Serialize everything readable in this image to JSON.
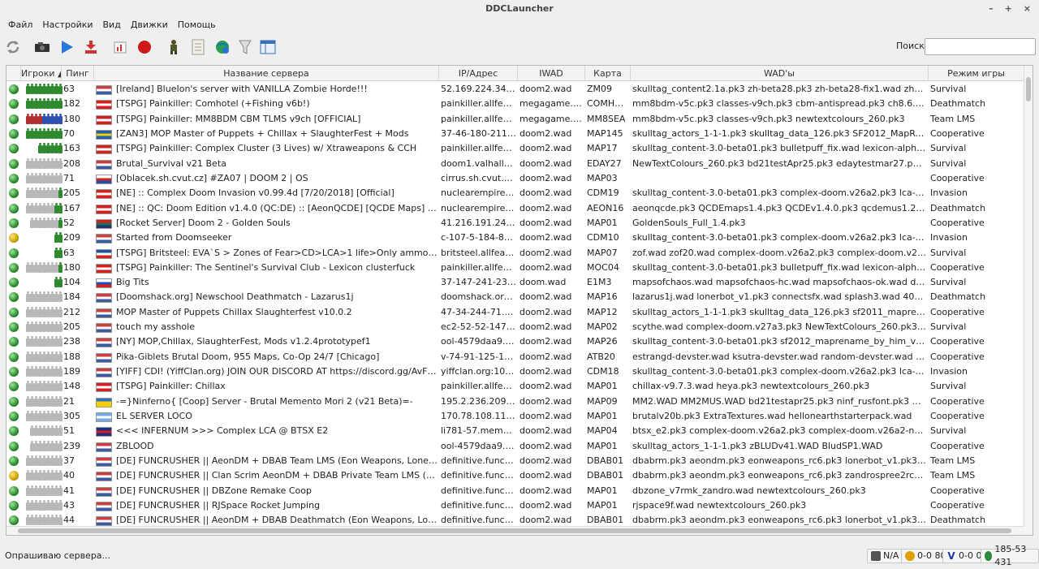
{
  "window": {
    "title": "DDCLauncher",
    "minimize_label": "–",
    "maximize_label": "+",
    "close_label": "×"
  },
  "menu": [
    {
      "label": "Файл"
    },
    {
      "label": "Настройки"
    },
    {
      "label": "Вид"
    },
    {
      "label": "Движки"
    },
    {
      "label": "Помощь"
    }
  ],
  "toolbar": {
    "icons": [
      "refresh-icon",
      "camera-icon",
      "play-icon",
      "download-icon",
      "chart-icon",
      "record-icon",
      "soldier-icon",
      "notes-icon",
      "globe-icon",
      "filter-icon",
      "window-icon"
    ]
  },
  "search": {
    "label": "Поиск:",
    "value": "",
    "placeholder": ""
  },
  "columns": {
    "players": "Игроки",
    "ping": "Пинг",
    "name": "Название сервера",
    "address": "IP/Адрес",
    "iwad": "IWAD",
    "map": "Карта",
    "wads": "WAD'ы",
    "mode": "Режим игры"
  },
  "servers": [
    {
      "players": [
        "g",
        "g",
        "g",
        "g",
        "g",
        "g",
        "g",
        "g",
        "g"
      ],
      "ping": "63",
      "flag": "us",
      "name": "[Ireland] BlueIon's server with VANILLA Zombie Horde!!!",
      "address": "52.169.224.34:106...",
      "iwad": "doom2.wad",
      "map": "ZM09",
      "wads": "skulltag_content2.1a.pk3 zh-beta28.pk3 zh-beta28-fix1.wad zh-testpack_r28.pk...",
      "mode": "Survival",
      "locked": false
    },
    {
      "players": [
        "g",
        "g",
        "g",
        "g",
        "g",
        "g",
        "g",
        "g",
        "g"
      ],
      "ping": "182",
      "flag": "ca",
      "name": "[TSPG] Painkiller: Comhotel (+Fishing v6b!)",
      "address": "painkiller.allfearth...",
      "iwad": "megagame.wad",
      "map": "COMHOT...",
      "wads": "mm8bdm-v5c.pk3 classes-v9ch.pk3 cbm-antispread.pk3 ch8.6.1.pk3 hotelfishi...",
      "mode": "Deathmatch",
      "locked": false
    },
    {
      "players": [
        "r",
        "r",
        "r",
        "r",
        "bl",
        "bl",
        "bl",
        "bl",
        "bl"
      ],
      "ping": "180",
      "flag": "ca",
      "name": "[TSPG] Painkiller: MM8BDM CBM TLMS v9ch [OFFICIAL]",
      "address": "painkiller.allfearth...",
      "iwad": "megagame.wad",
      "map": "MM8SEA",
      "wads": "mm8bdm-v5c.pk3 classes-v9ch.pk3 newtextcolours_260.pk3",
      "mode": "Team LMS",
      "locked": false
    },
    {
      "players": [
        "g",
        "g",
        "g",
        "g",
        "g",
        "g",
        "g",
        "g",
        "g"
      ],
      "ping": "70",
      "flag": "se",
      "name": "[ZAN3] MOP Master of Puppets + Chillax + SlaughterFest + Mods",
      "address": "37-46-180-211.cus...",
      "iwad": "doom2.wad",
      "map": "MAP145",
      "wads": "skulltag_actors_1-1-1.pk3 skulltag_data_126.pk3 SF2012_MapRename_by_HiM_...",
      "mode": "Cooperative",
      "locked": false
    },
    {
      "players": [
        "g",
        "g",
        "g",
        "g",
        "g",
        "g"
      ],
      "ping": "163",
      "flag": "ca",
      "name": "[TSPG] Painkiller: Complex Cluster (3 Lives) w/ Xtraweapons & CCH",
      "address": "painkiller.allfearth...",
      "iwad": "doom2.wad",
      "map": "MAP17",
      "wads": "skulltag_content-3.0-beta01.pk3 bulletpuff_fix.wad lexicon-alpha-build-82.pk3 ...",
      "mode": "Survival",
      "locked": false
    },
    {
      "players": [
        "w",
        "w",
        "w",
        "w",
        "w",
        "w",
        "w",
        "w",
        "w"
      ],
      "ping": "208",
      "flag": "us",
      "name": "Brutal_Survival v21 Beta",
      "address": "doom1.valhallaga...",
      "iwad": "doom2.wad",
      "map": "EDAY27",
      "wads": "NewTextColours_260.pk3 bd21testApr25.pk3 edaytestmar27.pk3 edaymusicte...",
      "mode": "Survival",
      "locked": false
    },
    {
      "players": [
        "w",
        "w",
        "w",
        "w",
        "w",
        "w",
        "w",
        "w",
        "w"
      ],
      "ping": "71",
      "flag": "cz",
      "name": "[Oblacek.sh.cvut.cz] #ZA07 | DOOM 2 | OS",
      "address": "cirrus.sh.cvut.cz:1...",
      "iwad": "doom2.wad",
      "map": "MAP03",
      "wads": "",
      "mode": "Cooperative",
      "locked": false
    },
    {
      "players": [
        "w",
        "w",
        "w",
        "w",
        "w",
        "w",
        "w",
        "w",
        "g"
      ],
      "ping": "205",
      "flag": "ca",
      "name": "[NE] :: Complex Doom Invasion v0.99.4d [7/20/2018] [Official]",
      "address": "nuclearempire.net...",
      "iwad": "doom2.wad",
      "map": "CDM19",
      "wads": "skulltag_content-3.0-beta01.pk3 complex-doom.v26a2.pk3 lca-v1.5.8.pk3 com...",
      "mode": "Invasion",
      "locked": false
    },
    {
      "players": [
        "w",
        "w",
        "w",
        "w",
        "w",
        "w",
        "w",
        "g",
        "g"
      ],
      "ping": "167",
      "flag": "ca",
      "name": "[NE] :: QC: Doom Edition v1.4.0 (QC:DE) :: [AeonQCDE] [QCDE Maps] [FFA]",
      "address": "nuclearempire.net...",
      "iwad": "doom2.wad",
      "map": "AEON16",
      "wads": "aeonqcde.pk3 QCDEmaps1.4.pk3 QCDEv1.4.0.pk3 qcdemus1.2.pk3 newtextcol...",
      "mode": "Deathmatch",
      "locked": false
    },
    {
      "players": [
        "w",
        "w",
        "w",
        "w",
        "w",
        "w",
        "w",
        "g"
      ],
      "ping": "52",
      "flag": "za",
      "name": "[Rocket Server] Doom 2 - Golden Souls",
      "address": "41.216.191.243:10...",
      "iwad": "doom2.wad",
      "map": "MAP01",
      "wads": "GoldenSouls_Full_1.4.pk3",
      "mode": "Cooperative",
      "locked": false
    },
    {
      "players": [
        "g",
        "g"
      ],
      "ping": "209",
      "flag": "us",
      "name": "Started from Doomseeker",
      "address": "c-107-5-184-81.hs...",
      "iwad": "doom2.wad",
      "map": "CDM10",
      "wads": "skulltag_content-3.0-beta01.pk3 complex-doom.v26a2.pk3 lca-v1.5.8.pk3 com...",
      "mode": "Invasion",
      "locked": true
    },
    {
      "players": [
        "g",
        "g"
      ],
      "ping": "63",
      "flag": "fr",
      "name": "[TSPG] Britsteel: EVA`S > Zones of Fear>CD>LCA>1 life>Only ammo respawn",
      "address": "britsteel.allfearthe...",
      "iwad": "doom2.wad",
      "map": "MAP07",
      "wads": "zof.wad zof20.wad complex-doom.v26a2.pk3 complex-doom.v26a2-nopush-v6...",
      "mode": "Survival",
      "locked": false
    },
    {
      "players": [
        "w",
        "w",
        "w",
        "w",
        "w",
        "w",
        "w",
        "w",
        "g"
      ],
      "ping": "180",
      "flag": "ca",
      "name": "[TSPG] Painkiller: The Sentinel's Survival Club - Lexicon clusterfuck",
      "address": "painkiller.allfearth...",
      "iwad": "doom2.wad",
      "map": "MOC04",
      "wads": "skulltag_content-3.0-beta01.pk3 bulletpuff_fix.wad lexicon-alpha-build-82.pk3 ...",
      "mode": "Cooperative",
      "locked": false
    },
    {
      "players": [
        "g",
        "g"
      ],
      "ping": "104",
      "flag": "ru",
      "name": "Big Tits",
      "address": "37-147-241-235.br...",
      "iwad": "doom.wad",
      "map": "E1M3",
      "wads": "mapsofchaos.wad mapsofchaos-hc.wad mapsofchaos-ok.wad doom metal pac...",
      "mode": "Survival",
      "locked": false
    },
    {
      "players": [
        "w",
        "w",
        "w",
        "w",
        "w",
        "w",
        "w",
        "w",
        "w"
      ],
      "ping": "184",
      "flag": "us",
      "name": "[Doomshack.org] Newschool Deathmatch - Lazarus1j",
      "address": "doomshack.org:1...",
      "iwad": "doom2.wad",
      "map": "MAP16",
      "wads": "lazarus1j.wad lonerbot_v1.pk3 connectsfx.wad splash3.wad 40skins.wad newt...",
      "mode": "Deathmatch",
      "locked": false
    },
    {
      "players": [
        "w",
        "w",
        "w",
        "w",
        "w",
        "w",
        "w",
        "w",
        "w"
      ],
      "ping": "212",
      "flag": "us",
      "name": "MOP Master of Puppets  Chillax Slaughterfest v10.0.2",
      "address": "47-34-244-71.dhcp...",
      "iwad": "doom2.wad",
      "map": "MAP12",
      "wads": "skulltag_actors_1-1-1.pk3 skulltag_data_126.pk3 sf2011_maprename_by_him_v...",
      "mode": "Cooperative",
      "locked": false
    },
    {
      "players": [
        "w",
        "w",
        "w",
        "w",
        "w",
        "w",
        "w",
        "w",
        "w"
      ],
      "ping": "205",
      "flag": "us",
      "name": "touch my asshole",
      "address": "ec2-52-52-147-37...",
      "iwad": "doom2.wad",
      "map": "MAP02",
      "wads": "scythe.wad complex-doom.v27a3.pk3 NewTextColours_260.pk3 hpbar-v15b.pk...",
      "mode": "Survival",
      "locked": false
    },
    {
      "players": [
        "w",
        "w",
        "w",
        "w",
        "w",
        "w",
        "w",
        "w",
        "w"
      ],
      "ping": "238",
      "flag": "us",
      "name": "[NY] MOP,Chillax, SlaughterFest, Mods v1.2.4prototypef1",
      "address": "ool-4579daa9.dyn...",
      "iwad": "doom2.wad",
      "map": "MAP26",
      "wads": "skulltag_content-3.0-beta01.pk3 sf2012_maprename_by_him_v1.3.wad sf2011...",
      "mode": "Cooperative",
      "locked": false
    },
    {
      "players": [
        "w",
        "w",
        "w",
        "w",
        "w",
        "w",
        "w",
        "w",
        "w"
      ],
      "ping": "188",
      "flag": "us",
      "name": "Pika-Giblets Brutal Doom, 955 Maps, Co-Op 24/7 [Chicago]",
      "address": "v-74-91-125-154.u...",
      "iwad": "doom2.wad",
      "map": "ATB20",
      "wads": "estrangd-devster.wad ksutra-devster.wad random-devster.wad hellnovaatbb3...",
      "mode": "Cooperative",
      "locked": false
    },
    {
      "players": [
        "w",
        "w",
        "w",
        "w",
        "w",
        "w",
        "w",
        "w",
        "w"
      ],
      "ping": "189",
      "flag": "us",
      "name": "[YIFF] CDI! (YiffClan.org) JOIN OUR DISCORD AT https://discord.gg/AvFPGsW",
      "address": "yiffclan.org:10666",
      "iwad": "doom2.wad",
      "map": "CDM18",
      "wads": "skulltag_content-3.0-beta01.pk3 complex-doom.v26a2.pk3 lca-v1.5.8.pk3 com...",
      "mode": "Invasion",
      "locked": false
    },
    {
      "players": [
        "w",
        "w",
        "w",
        "w",
        "w",
        "w",
        "w",
        "w",
        "w"
      ],
      "ping": "148",
      "flag": "ca",
      "name": "[TSPG] Painkiller: Chillax",
      "address": "painkiller.allfearth...",
      "iwad": "doom2.wad",
      "map": "MAP01",
      "wads": "chillax-v9.7.3.wad heya.pk3 newtextcolours_260.pk3",
      "mode": "Survival",
      "locked": false
    },
    {
      "players": [
        "w",
        "w",
        "w",
        "w",
        "w",
        "w",
        "w",
        "w",
        "w"
      ],
      "ping": "21",
      "flag": "ua",
      "name": "-=}Ninferno{ [Coop] Server - Brutal Memento Mori 2 (v21 Beta)=-",
      "address": "195.2.236.209:6670",
      "iwad": "doom2.wad",
      "map": "MAP09",
      "wads": "MM2.WAD MM2MUS.WAD bd21testapr25.pk3 ninf_rusfont.pk3 mm2_ogg.pk3",
      "mode": "Cooperative",
      "locked": false
    },
    {
      "players": [
        "w",
        "w",
        "w",
        "w",
        "w",
        "w",
        "w",
        "w",
        "w"
      ],
      "ping": "305",
      "flag": "ar",
      "name": "EL SERVER LOCO",
      "address": "170.78.108.110:22...",
      "iwad": "doom2.wad",
      "map": "MAP01",
      "wads": "brutalv20b.pk3 ExtraTextures.wad hellonearthstarterpack.wad",
      "mode": "Cooperative",
      "locked": false
    },
    {
      "players": [
        "w",
        "w",
        "w",
        "w",
        "w",
        "w",
        "w",
        "w"
      ],
      "ping": "51",
      "flag": "gb",
      "name": "<<< INFERNUM >>> Complex LCA @ BTSX E2",
      "address": "li781-57.members...",
      "iwad": "doom2.wad",
      "map": "MAP04",
      "wads": "btsx_e2.pk3 complex-doom.v26a2.pk3 complex-doom.v26a2-nopush-v6.pk3 c...",
      "mode": "Survival",
      "locked": false
    },
    {
      "players": [
        "w",
        "w",
        "w",
        "w",
        "w",
        "w",
        "w",
        "w"
      ],
      "ping": "239",
      "flag": "us",
      "name": "ZBLOOD",
      "address": "ool-4579daa9.dyn...",
      "iwad": "doom2.wad",
      "map": "MAP01",
      "wads": "skulltag_actors_1-1-1.pk3 zBLUDv41.WAD BludSP1.WAD",
      "mode": "Cooperative",
      "locked": false
    },
    {
      "players": [
        "w",
        "w",
        "w",
        "w",
        "w",
        "w",
        "w",
        "w",
        "w"
      ],
      "ping": "37",
      "flag": "us",
      "name": "[DE] FUNCRUSHER || AeonDM + DBAB Team LMS (Eon Weapons, LonerBot)",
      "address": "definitive.funcrus...",
      "iwad": "doom2.wad",
      "map": "DBAB01",
      "wads": "dbabrm.pk3 aeondm.pk3 eonweapons_rc6.pk3 lonerbot_v1.pk3 zandrospree2...",
      "mode": "Team LMS",
      "locked": false
    },
    {
      "players": [
        "w",
        "w",
        "w",
        "w",
        "w",
        "w",
        "w",
        "w",
        "w"
      ],
      "ping": "40",
      "flag": "us",
      "name": "[DE] FUNCRUSHER || Clan Scrim AeonDM + DBAB Private Team LMS (Eon Weapons)",
      "address": "definitive.funcrus...",
      "iwad": "doom2.wad",
      "map": "DBAB01",
      "wads": "dbabrm.pk3 aeondm.pk3 eonweapons_rc6.pk3 zandrospree2rc2.pk3 newtextc...",
      "mode": "Team LMS",
      "locked": true
    },
    {
      "players": [
        "w",
        "w",
        "w",
        "w",
        "w",
        "w",
        "w",
        "w",
        "w"
      ],
      "ping": "41",
      "flag": "us",
      "name": "[DE] FUNCRUSHER || DBZone Remake Coop",
      "address": "definitive.funcrus...",
      "iwad": "doom2.wad",
      "map": "MAP01",
      "wads": "dbzone_v7rmk_zandro.wad newtextcolours_260.pk3",
      "mode": "Cooperative",
      "locked": false
    },
    {
      "players": [
        "w",
        "w",
        "w",
        "w",
        "w",
        "w",
        "w",
        "w",
        "w"
      ],
      "ping": "43",
      "flag": "us",
      "name": "[DE] FUNCRUSHER || RJSpace Rocket Jumping",
      "address": "definitive.funcrus...",
      "iwad": "doom2.wad",
      "map": "MAP01",
      "wads": "rjspace9f.wad newtextcolours_260.pk3",
      "mode": "Cooperative",
      "locked": false
    },
    {
      "players": [
        "w",
        "w",
        "w",
        "w",
        "w",
        "w",
        "w",
        "w",
        "w"
      ],
      "ping": "44",
      "flag": "us",
      "name": "[DE] FUNCRUSHER || AeonDM + DBAB Deathmatch (Eon Weapons, LonerBot)",
      "address": "definitive.funcrus...",
      "iwad": "doom2.wad",
      "map": "DBAB01",
      "wads": "dbabrm.pk3 aeondm.pk3 eonweapons_rc6.pk3 lonerbot_v1.pk3 zandrospree2...",
      "mode": "Deathmatch",
      "locked": false
    }
  ],
  "flag_colors": {
    "us": [
      "#c84040",
      "#ffffff",
      "#3c5aa0"
    ],
    "ca": [
      "#d02020",
      "#ffffff",
      "#d02020"
    ],
    "se": [
      "#2060b0",
      "#f0d000",
      "#2060b0"
    ],
    "cz": [
      "#ffffff",
      "#d02020",
      "#2050a0"
    ],
    "za": [
      "#d02020",
      "#207040",
      "#203080"
    ],
    "fr": [
      "#2050a0",
      "#ffffff",
      "#d02020"
    ],
    "ru": [
      "#ffffff",
      "#2050b0",
      "#d02020"
    ],
    "ua": [
      "#2a70c8",
      "#f4d000",
      "#f4d000"
    ],
    "ar": [
      "#74acdf",
      "#ffffff",
      "#74acdf"
    ],
    "gb": [
      "#203080",
      "#d02020",
      "#203080"
    ]
  },
  "status": {
    "text": "Опрашиваю сервера...",
    "items": [
      {
        "icon": "network-icon",
        "label": "N/A"
      },
      {
        "icon": "zandronum-icon",
        "label": "0-0 80"
      },
      {
        "icon": "v-engine-icon",
        "label": "0-0 0"
      },
      {
        "icon": "globe-icon",
        "label": "185-53 431"
      }
    ]
  }
}
